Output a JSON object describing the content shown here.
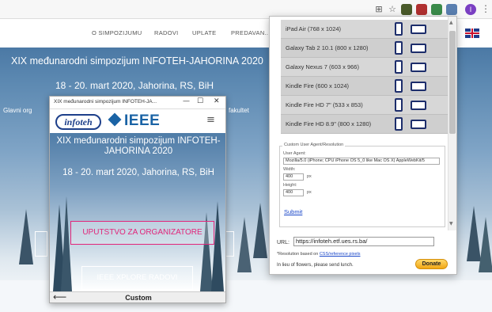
{
  "site": {
    "nav": [
      "O SIMPOZIJUMU",
      "RADOVI",
      "UPLATE",
      "PREDAVAN..."
    ],
    "title": "XIX međunarodni simpozijum INFOTEH-JAHORINA 2020",
    "date": "18 - 20. mart 2020, Jahorina, RS, BiH",
    "org": "Glavni org",
    "fak": "fakultet"
  },
  "mobile": {
    "window_title": "XIX međunarodni simpozijum INFOTEH-JA...",
    "minimize": "—",
    "maximize": "☐",
    "close": "✕",
    "logo_infoteh": "infoteh",
    "logo_ieee": "IEEE",
    "hamburger": "≡",
    "title": "XIX međunarodni simpozijum INFOTEH-JAHORINA 2020",
    "date": "18 - 20. mart 2020, Jahorina, RS, BiH",
    "button_org": "UPUTSTVO ZA ORGANIZATORE",
    "button_ieee": "IEEE XPLORE RADOVI",
    "back": "⟵",
    "footer_label": "Custom"
  },
  "popup": {
    "devices": [
      {
        "name": "iPad Air (768 x 1024)"
      },
      {
        "name": "Galaxy Tab 2 10.1 (800 x 1280)"
      },
      {
        "name": "Galaxy Nexus 7 (603 x 966)"
      },
      {
        "name": "Kindle Fire (600 x 1024)"
      },
      {
        "name": "Kindle Fire HD 7\" (533 x 853)"
      },
      {
        "name": "Kindle Fire HD 8.9\" (800 x 1280)"
      }
    ],
    "custom": {
      "legend": "Custom User Agent/Resolution",
      "ua_label": "User Agent:",
      "ua_value": "Mozilla/5.0 (iPhone; CPU iPhone OS 5_0 like Mac OS X) AppleWebKit/5",
      "width_label": "Width:",
      "width_value": "400",
      "height_label": "Height:",
      "height_value": "400",
      "px": "px",
      "submit": "Submit"
    },
    "url_label": "URL:",
    "url_value": "https://infoteh.etf.ues.rs.ba/",
    "res_note_prefix": "*Resolution based on ",
    "res_note_link": "CSS/reference pixels",
    "lieu": "In lieu of flowers, please send lunch.",
    "donate": "Donate"
  }
}
